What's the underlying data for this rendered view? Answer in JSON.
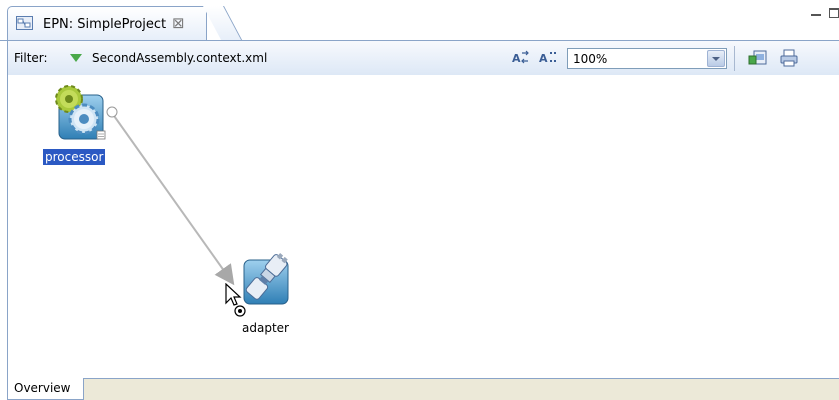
{
  "editor": {
    "tab_title": "EPN: SimpleProject",
    "close_glyph": "⊠"
  },
  "toolbar": {
    "filter_label": "Filter:",
    "filter_value": "SecondAssembly.context.xml",
    "zoom_value": "100%"
  },
  "diagram": {
    "nodes": [
      {
        "id": "processor",
        "label": "processor",
        "icon": "processor-gears-icon",
        "selected": true
      },
      {
        "id": "adapter",
        "label": "adapter",
        "icon": "adapter-plug-icon",
        "selected": false
      }
    ],
    "edges": [
      {
        "from": "processor",
        "to": "adapter"
      }
    ]
  },
  "bottom_tabs": {
    "overview": "Overview"
  },
  "colors": {
    "selection": "#2b59c3",
    "edge": "#b8b8b8",
    "tab_border": "#8aa4c8"
  }
}
